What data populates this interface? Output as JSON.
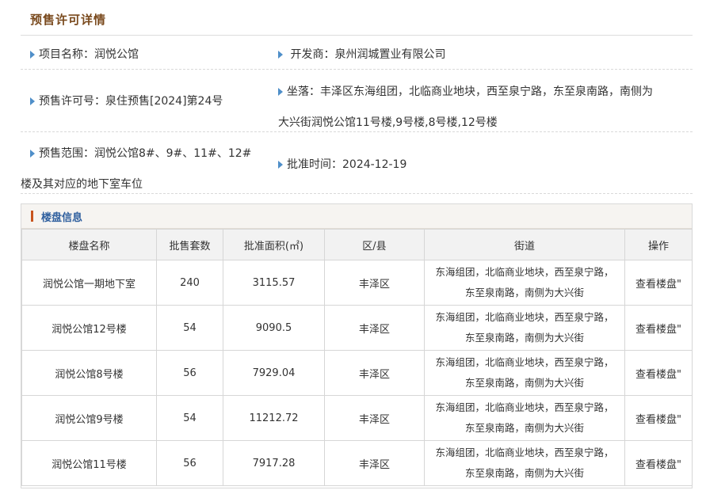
{
  "page": {
    "title": "预售许可详情"
  },
  "info": {
    "project_name": "项目名称：润悦公馆",
    "developer": "开发商：泉州润城置业有限公司",
    "permit_no": "预售许可号：泉住预售[2024]第24号",
    "location_line1": "坐落：丰泽区东海组团，北临商业地块，西至泉宁路，东至泉南路，南侧为",
    "location_line2": "大兴街润悦公馆11号楼,9号楼,8号楼,12号楼",
    "scope_line1": "预售范围：润悦公馆8#、9#、11#、12#",
    "scope_line2": "楼及其对应的地下室车位",
    "approval_date": "批准时间：2024-12-19"
  },
  "panel": {
    "title": "楼盘信息"
  },
  "table": {
    "headers": [
      "楼盘名称",
      "批售套数",
      "批准面积(㎡)",
      "区/县",
      "街道",
      "操作"
    ],
    "rows": [
      {
        "name": "润悦公馆一期地下室",
        "units": "240",
        "area": "3115.57",
        "district": "丰泽区",
        "street1": "东海组团，北临商业地块，西至泉宁路，",
        "street2": "东至泉南路，南侧为大兴街",
        "action": "查看楼盘\""
      },
      {
        "name": "润悦公馆12号楼",
        "units": "54",
        "area": "9090.5",
        "district": "丰泽区",
        "street1": "东海组团，北临商业地块，西至泉宁路，",
        "street2": "东至泉南路，南侧为大兴街",
        "action": "查看楼盘\""
      },
      {
        "name": "润悦公馆8号楼",
        "units": "56",
        "area": "7929.04",
        "district": "丰泽区",
        "street1": "东海组团，北临商业地块，西至泉宁路，",
        "street2": "东至泉南路，南侧为大兴街",
        "action": "查看楼盘\""
      },
      {
        "name": "润悦公馆9号楼",
        "units": "54",
        "area": "11212.72",
        "district": "丰泽区",
        "street1": "东海组团，北临商业地块，西至泉宁路，",
        "street2": "东至泉南路，南侧为大兴街",
        "action": "查看楼盘\""
      },
      {
        "name": "润悦公馆11号楼",
        "units": "56",
        "area": "7917.28",
        "district": "丰泽区",
        "street1": "东海组团，北临商业地块，西至泉宁路，",
        "street2": "东至泉南路，南侧为大兴街",
        "action": "查看楼盘\""
      }
    ]
  }
}
